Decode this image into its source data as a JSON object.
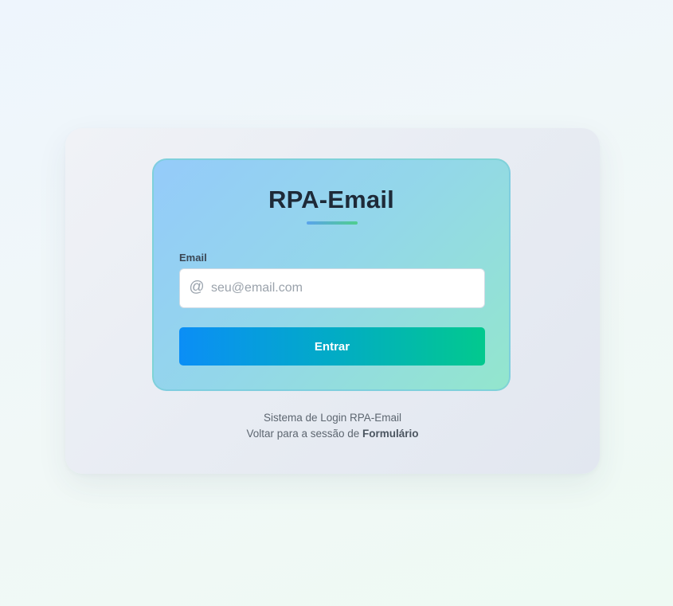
{
  "login": {
    "title": "RPA-Email",
    "email_label": "Email",
    "email_icon": "at-icon",
    "email_icon_glyph": "@",
    "email_placeholder": "seu@email.com",
    "email_value": "",
    "submit_label": "Entrar"
  },
  "footer": {
    "system_text": "Sistema de Login RPA-Email",
    "back_prefix": "Voltar para a sessão de ",
    "back_link": "Formulário"
  },
  "colors": {
    "title": "#1e2a38",
    "button_gradient_start": "#0b8ef6",
    "button_gradient_end": "#02c98e",
    "underline_start": "#5aa3ec",
    "underline_end": "#4fce8e"
  }
}
